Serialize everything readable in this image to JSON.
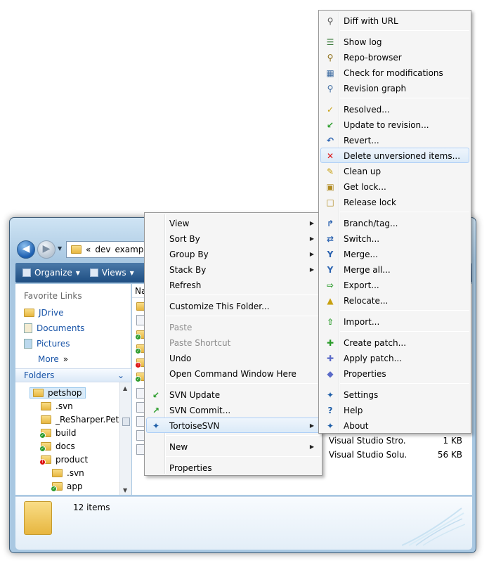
{
  "window": {
    "address": {
      "chevrons": "«",
      "segment1": "dev",
      "segment2": "examp"
    },
    "toolbar": {
      "organize": "Organize",
      "views": "Views"
    },
    "favorite_links": {
      "title": "Favorite Links",
      "items": [
        "JDrive",
        "Documents",
        "Pictures"
      ],
      "more": "More",
      "more_glyph": "»"
    },
    "folders_header": "Folders",
    "tree": [
      {
        "label": "petshop"
      },
      {
        "label": ".svn"
      },
      {
        "label": "_ReSharper.PetSh"
      },
      {
        "label": "build"
      },
      {
        "label": "docs"
      },
      {
        "label": "product"
      },
      {
        "label": ".svn"
      },
      {
        "label": "app"
      }
    ],
    "column_name": "Nan",
    "files": [
      {
        "name": "Visual Studio Stro...",
        "size": "1 KB"
      },
      {
        "name": "Visual Studio Solu...",
        "size": "56 KB"
      }
    ],
    "status": "12 items"
  },
  "context_menu": {
    "items": [
      {
        "label": "View",
        "submenu": true
      },
      {
        "label": "Sort By",
        "submenu": true
      },
      {
        "label": "Group By",
        "submenu": true
      },
      {
        "label": "Stack By",
        "submenu": true
      },
      {
        "label": "Refresh"
      },
      {
        "label": "Customize This Folder..."
      },
      {
        "label": "Paste",
        "disabled": true
      },
      {
        "label": "Paste Shortcut",
        "disabled": true
      },
      {
        "label": "Undo"
      },
      {
        "label": "Open Command Window Here"
      },
      {
        "label": "SVN Update",
        "icon": "svn-update-icon"
      },
      {
        "label": "SVN Commit...",
        "icon": "svn-commit-icon"
      },
      {
        "label": "TortoiseSVN",
        "icon": "tortoisesvn-icon",
        "submenu": true,
        "highlighted": true
      },
      {
        "label": "New",
        "submenu": true
      },
      {
        "label": "Properties"
      }
    ]
  },
  "tortoise_menu": {
    "items": [
      {
        "label": "Diff with URL",
        "icon": "diff-icon"
      },
      {
        "label": "Show log",
        "icon": "show-log-icon"
      },
      {
        "label": "Repo-browser",
        "icon": "repo-browser-icon"
      },
      {
        "label": "Check for modifications",
        "icon": "check-modifications-icon"
      },
      {
        "label": "Revision graph",
        "icon": "revision-graph-icon"
      },
      {
        "label": "Resolved...",
        "icon": "resolved-icon"
      },
      {
        "label": "Update to revision...",
        "icon": "update-revision-icon"
      },
      {
        "label": "Revert...",
        "icon": "revert-icon"
      },
      {
        "label": "Delete unversioned items...",
        "icon": "delete-icon",
        "highlighted": true
      },
      {
        "label": "Clean up",
        "icon": "cleanup-icon"
      },
      {
        "label": "Get lock...",
        "icon": "lock-icon"
      },
      {
        "label": "Release lock",
        "icon": "unlock-icon"
      },
      {
        "label": "Branch/tag...",
        "icon": "branch-icon"
      },
      {
        "label": "Switch...",
        "icon": "switch-icon"
      },
      {
        "label": "Merge...",
        "icon": "merge-icon"
      },
      {
        "label": "Merge all...",
        "icon": "merge-all-icon"
      },
      {
        "label": "Export...",
        "icon": "export-icon"
      },
      {
        "label": "Relocate...",
        "icon": "relocate-icon"
      },
      {
        "label": "Import...",
        "icon": "import-icon"
      },
      {
        "label": "Create patch...",
        "icon": "create-patch-icon"
      },
      {
        "label": "Apply patch...",
        "icon": "apply-patch-icon"
      },
      {
        "label": "Properties",
        "icon": "properties-icon"
      },
      {
        "label": "Settings",
        "icon": "settings-icon"
      },
      {
        "label": "Help",
        "icon": "help-icon"
      },
      {
        "label": "About",
        "icon": "about-icon"
      }
    ]
  },
  "colors": {
    "highlight_border": "#aecff7",
    "highlight_fill": "#dbeaf8",
    "link": "#1a55a8",
    "delete_red": "#d11"
  }
}
